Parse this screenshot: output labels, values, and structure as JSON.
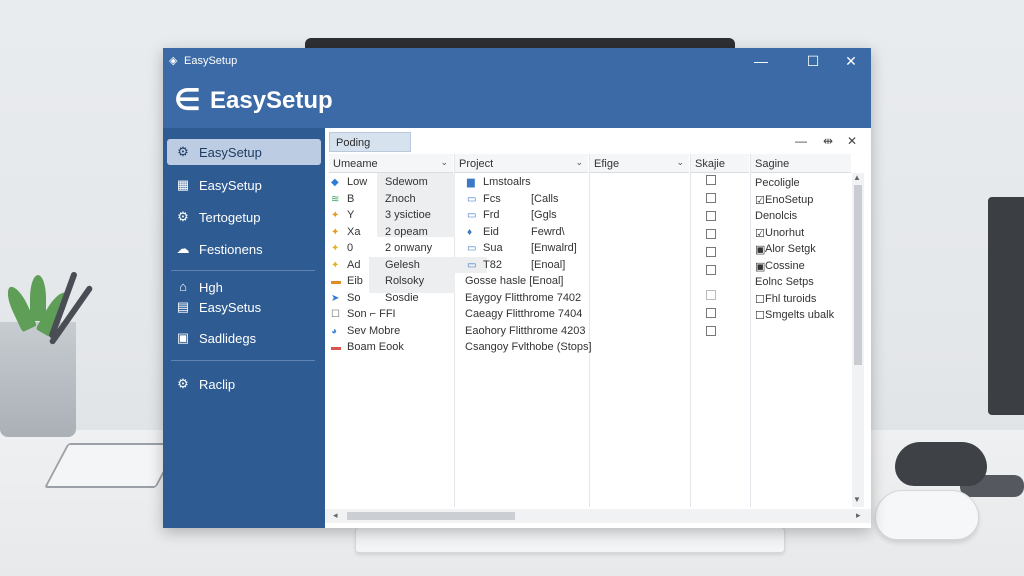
{
  "window": {
    "title": "EasySetup",
    "controls": {
      "minimize": "—",
      "maximize": "☐",
      "close": "✕"
    }
  },
  "header": {
    "logo_glyph": "∈",
    "brand": "EasySetup"
  },
  "sidebar": {
    "items": [
      {
        "label": "EasySetup",
        "icon": "setup-icon",
        "glyph": "⚙",
        "active": true
      },
      {
        "label": "EasySetup",
        "icon": "grid-icon",
        "glyph": "▦"
      },
      {
        "label": "Tertogetup",
        "icon": "gear-icon",
        "glyph": "⚙"
      },
      {
        "label": "Festionens",
        "icon": "cloud-icon",
        "glyph": "☁"
      },
      {
        "label": "Hgh",
        "icon": "folder-icon",
        "glyph": "⌂"
      },
      {
        "label": "EasySetus",
        "icon": "document-icon",
        "glyph": "▤"
      },
      {
        "label": "Sadlidegs",
        "icon": "calendar-icon",
        "glyph": "▣"
      },
      {
        "label": "Raclip",
        "icon": "settings-icon",
        "glyph": "⚙"
      }
    ]
  },
  "panel": {
    "tab": "Poding",
    "controls": {
      "minimize": "—",
      "pin": "⇹",
      "close": "✕"
    },
    "columns": [
      "Umeame",
      "Project",
      "Efige",
      "Skajie",
      "Sagine"
    ],
    "name_rows": [
      {
        "icon_glyph": "◆",
        "icon_color": "#2f7bd6",
        "a": "Low",
        "b": "Sdewom"
      },
      {
        "icon_glyph": "≋",
        "icon_color": "#3aa35c",
        "a": "B",
        "b": "Znoch"
      },
      {
        "icon_glyph": "✦",
        "icon_color": "#e69a1f",
        "a": "Y",
        "b": "3 ysictioe"
      },
      {
        "icon_glyph": "✦",
        "icon_color": "#e69a1f",
        "a": "Xa",
        "b": "2 opeam"
      },
      {
        "icon_glyph": "✦",
        "icon_color": "#e6b11f",
        "a": "0",
        "b": "2 onwany"
      },
      {
        "icon_glyph": "✦",
        "icon_color": "#e6b11f",
        "a": "Ad",
        "b": "Gelesh"
      },
      {
        "icon_glyph": "▬",
        "icon_color": "#e08a2a",
        "a": "Eib",
        "b": "Rolsoky"
      },
      {
        "icon_glyph": "➤",
        "icon_color": "#2f7bd6",
        "a": "So",
        "b": "Sosdie"
      },
      {
        "icon_glyph": "☐",
        "icon_color": "#666666",
        "a": "Son ⌐ FFI",
        "b": ""
      },
      {
        "icon_glyph": "◕",
        "icon_color": "#4a8ad6",
        "a": "Sev Mobre",
        "b": ""
      },
      {
        "icon_glyph": "▬",
        "icon_color": "#d9534f",
        "a": "Boam Eook",
        "b": ""
      }
    ],
    "project_rows": [
      {
        "icon_glyph": "▆",
        "icon_color": "#3d78c7",
        "a": "Lmstoalrs",
        "b": ""
      },
      {
        "icon_glyph": "▭",
        "icon_color": "#3d78c7",
        "a": "Fcs",
        "b": "[Calls"
      },
      {
        "icon_glyph": "▭",
        "icon_color": "#3d78c7",
        "a": "Frd",
        "b": "[Ggls"
      },
      {
        "icon_glyph": "♦",
        "icon_color": "#3d78c7",
        "a": "Eid",
        "b": "Fewrd\\"
      },
      {
        "icon_glyph": "▭",
        "icon_color": "#3d78c7",
        "a": "Sua",
        "b": "[Enwalrd]"
      },
      {
        "icon_glyph": "▭",
        "icon_color": "#3d78c7",
        "a": "T82",
        "b": "[Enoal]"
      },
      {
        "icon_glyph": "",
        "icon_color": "#3d78c7",
        "a": "Gosse hasle [Enoal]",
        "b": ""
      },
      {
        "icon_glyph": "",
        "icon_color": "#3d78c7",
        "a": "Eaygoy Flitthrome 7402",
        "b": ""
      },
      {
        "icon_glyph": "",
        "icon_color": "#3d78c7",
        "a": "Caeagy Flitthrome 7404",
        "b": ""
      },
      {
        "icon_glyph": "",
        "icon_color": "#3d78c7",
        "a": "Eaohory Flitthrome 4203",
        "b": ""
      },
      {
        "icon_glyph": "",
        "icon_color": "#3d78c7",
        "a": "Csangoy Fvlthobe (Stops]",
        "b": ""
      }
    ],
    "stage_checks": [
      {
        "state": "unchecked"
      },
      {
        "state": "unchecked"
      },
      {
        "state": "unchecked"
      },
      {
        "state": "unchecked"
      },
      {
        "state": "unchecked"
      },
      {
        "state": "unchecked"
      },
      {
        "state": "dim"
      },
      {
        "state": "unchecked"
      },
      {
        "state": "unchecked"
      }
    ],
    "settings_rows": [
      {
        "glyph": "",
        "label": "Pecoligle"
      },
      {
        "glyph": "☑",
        "label": "EnoSetup"
      },
      {
        "glyph": "",
        "label": "Denolcis"
      },
      {
        "glyph": "☑",
        "label": "Unorhut"
      },
      {
        "glyph": "▣",
        "label": "Alor Setgk"
      },
      {
        "glyph": "▣",
        "label": "Cossine"
      },
      {
        "glyph": "",
        "label": "Eolnc Setps"
      },
      {
        "glyph": "☐",
        "label": "Fhl turoids"
      },
      {
        "glyph": "☐",
        "label": "Smgelts ubalk"
      }
    ],
    "scroll": {
      "up": "▲",
      "down": "▼",
      "left": "◂",
      "right": "▸"
    }
  }
}
